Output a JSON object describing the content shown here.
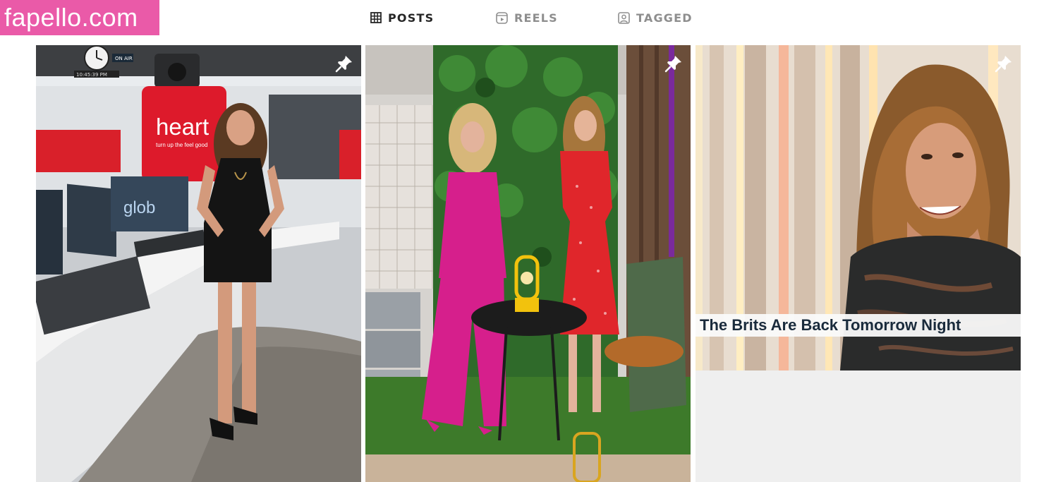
{
  "site": {
    "logo_text": "fapello.com"
  },
  "tabs": [
    {
      "label": "POSTS",
      "icon": "grid-icon",
      "active": true
    },
    {
      "label": "REELS",
      "icon": "reels-icon",
      "active": false
    },
    {
      "label": "TAGGED",
      "icon": "tagged-icon",
      "active": false
    }
  ],
  "posts": [
    {
      "pinned": true,
      "overlay_text": "heart",
      "overlay_subtext": "turn up the feel good",
      "overlay_text_2": "glob",
      "clock_text": "10:45:39 PM",
      "on_air_text": "ON AIR"
    },
    {
      "pinned": true
    },
    {
      "pinned": true,
      "caption": "The Brits Are Back Tomorrow Night"
    }
  ],
  "colors": {
    "brand": "#ea5aa8",
    "active_tab": "#262626",
    "inactive_tab": "#8e8e8e"
  }
}
